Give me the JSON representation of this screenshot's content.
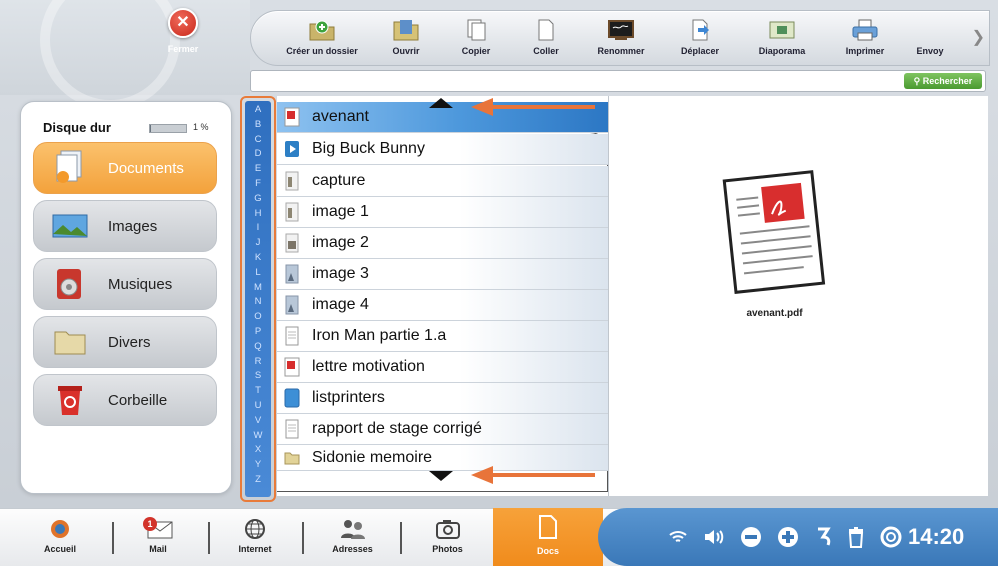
{
  "window": {
    "close_label": "Fermer"
  },
  "toolbar": {
    "items": [
      {
        "label": "Créer un dossier",
        "icon": "new-folder-icon"
      },
      {
        "label": "Ouvrir",
        "icon": "open-folder-icon"
      },
      {
        "label": "Copier",
        "icon": "copy-icon"
      },
      {
        "label": "Coller",
        "icon": "paste-icon"
      },
      {
        "label": "Renommer",
        "icon": "rename-icon"
      },
      {
        "label": "Déplacer",
        "icon": "move-icon"
      },
      {
        "label": "Diaporama",
        "icon": "slideshow-icon"
      },
      {
        "label": "Imprimer",
        "icon": "printer-icon"
      },
      {
        "label": "Envoy",
        "icon": "send-icon"
      }
    ]
  },
  "search": {
    "value": "",
    "button_label": "Rechercher"
  },
  "sidebar": {
    "disk_label": "Disque dur",
    "disk_usage_percent": 1,
    "disk_usage_text": "1 %",
    "categories": [
      {
        "label": "Documents",
        "icon": "documents-icon",
        "active": true
      },
      {
        "label": "Images",
        "icon": "images-icon",
        "active": false
      },
      {
        "label": "Musiques",
        "icon": "music-icon",
        "active": false
      },
      {
        "label": "Divers",
        "icon": "folder-icon",
        "active": false
      },
      {
        "label": "Corbeille",
        "icon": "trash-icon",
        "active": false
      }
    ]
  },
  "alphabet": [
    "A",
    "B",
    "C",
    "D",
    "E",
    "F",
    "G",
    "H",
    "I",
    "J",
    "K",
    "L",
    "M",
    "N",
    "O",
    "P",
    "Q",
    "R",
    "S",
    "T",
    "U",
    "V",
    "W",
    "X",
    "Y",
    "Z"
  ],
  "files": [
    {
      "name": "avenant",
      "icon": "pdf-icon",
      "selected": true
    },
    {
      "name": "Big Buck Bunny",
      "icon": "video-icon",
      "selected": false
    },
    {
      "name": "capture",
      "icon": "image-icon",
      "selected": false
    },
    {
      "name": "image 1",
      "icon": "image-icon",
      "selected": false
    },
    {
      "name": "image 2",
      "icon": "image-icon",
      "selected": false
    },
    {
      "name": "image 3",
      "icon": "image-icon",
      "selected": false
    },
    {
      "name": "image 4",
      "icon": "image-icon",
      "selected": false
    },
    {
      "name": "Iron Man partie 1.a",
      "icon": "document-icon",
      "selected": false
    },
    {
      "name": "lettre motivation",
      "icon": "pdf-icon",
      "selected": false
    },
    {
      "name": "listprinters",
      "icon": "blue-file-icon",
      "selected": false
    },
    {
      "name": "rapport de stage corrigé",
      "icon": "document-icon",
      "selected": false
    },
    {
      "name": "Sidonie memoire",
      "icon": "folder-icon",
      "selected": false
    }
  ],
  "preview": {
    "filename": "avenant.pdf",
    "icon": "pdf-document-icon"
  },
  "taskbar": {
    "items": [
      {
        "label": "Accueil",
        "icon": "home-icon"
      },
      {
        "label": "Mail",
        "icon": "mail-icon",
        "badge": "1"
      },
      {
        "label": "Internet",
        "icon": "globe-icon"
      },
      {
        "label": "Adresses",
        "icon": "contacts-icon"
      },
      {
        "label": "Photos",
        "icon": "camera-icon"
      }
    ],
    "active": {
      "label": "Docs",
      "icon": "docs-icon"
    },
    "tray": {
      "icons": [
        "wifi-icon",
        "volume-icon",
        "volume-down-icon",
        "volume-up-icon",
        "undo-icon",
        "trash-icon",
        "help-icon"
      ],
      "clock": "14:20"
    }
  }
}
